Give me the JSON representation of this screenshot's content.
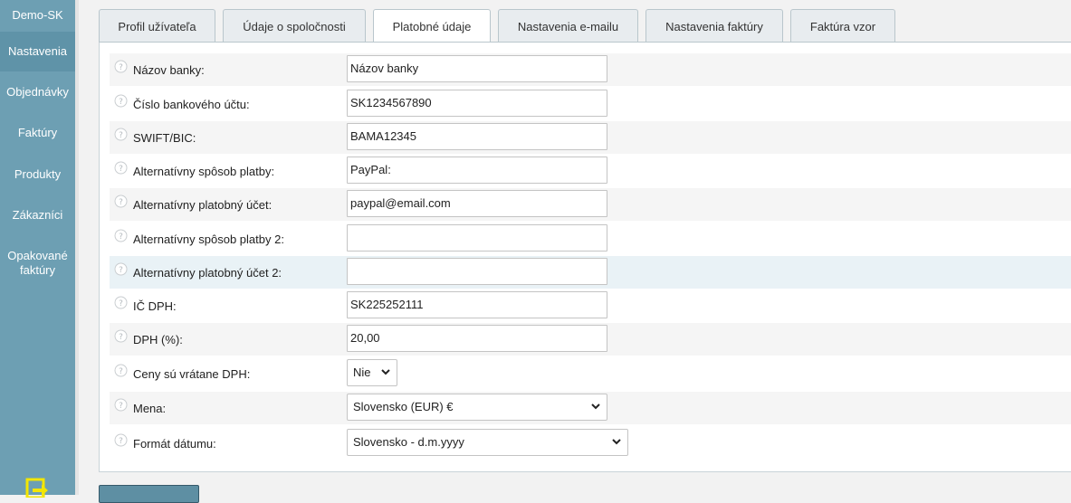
{
  "sidebar": {
    "brand": "Demo-SK",
    "items": [
      {
        "label": "Nastavenia",
        "active": true
      },
      {
        "label": "Objednávky"
      },
      {
        "label": "Faktúry"
      },
      {
        "label": "Produkty"
      },
      {
        "label": "Zákazníci"
      },
      {
        "label": "Opakované faktúry"
      }
    ]
  },
  "tabs": [
    {
      "label": "Profil užívateľa"
    },
    {
      "label": "Údaje o spoločnosti"
    },
    {
      "label": "Platobné údaje",
      "active": true
    },
    {
      "label": "Nastavenia e-mailu"
    },
    {
      "label": "Nastavenia faktúry"
    },
    {
      "label": "Faktúra vzor"
    }
  ],
  "form": {
    "bank_name": {
      "label": "Názov banky:",
      "value": "Názov banky"
    },
    "account_number": {
      "label": "Číslo bankového účtu:",
      "value": "SK1234567890"
    },
    "swift": {
      "label": "SWIFT/BIC:",
      "value": "BAMA12345"
    },
    "alt_method": {
      "label": "Alternatívny spôsob platby:",
      "value": "PayPal:"
    },
    "alt_account": {
      "label": "Alternatívny platobný účet:",
      "value": "paypal@email.com"
    },
    "alt_method_2": {
      "label": "Alternatívny spôsob platby 2:",
      "value": ""
    },
    "alt_account_2": {
      "label": "Alternatívny platobný účet 2:",
      "value": ""
    },
    "vat_id": {
      "label": "IČ DPH:",
      "value": "SK225252111"
    },
    "vat_rate": {
      "label": "DPH (%):",
      "value": "20,00"
    },
    "prices_incl_vat": {
      "label": "Ceny sú vrátane DPH:",
      "value": "Nie"
    },
    "currency": {
      "label": "Mena:",
      "value": "Slovensko (EUR) €"
    },
    "date_format": {
      "label": "Formát dátumu:",
      "value": "Slovensko - d.m.yyyy"
    }
  },
  "colors": {
    "sidebar": "#6d9fb3",
    "sidebar_active": "#5f93a8",
    "row_highlight": "#e9f2f6",
    "save_button": "#5e8fa3"
  },
  "icons": {
    "help": "question-circle-icon",
    "logout": "exit-icon",
    "chevron": "chevron-down-icon"
  }
}
